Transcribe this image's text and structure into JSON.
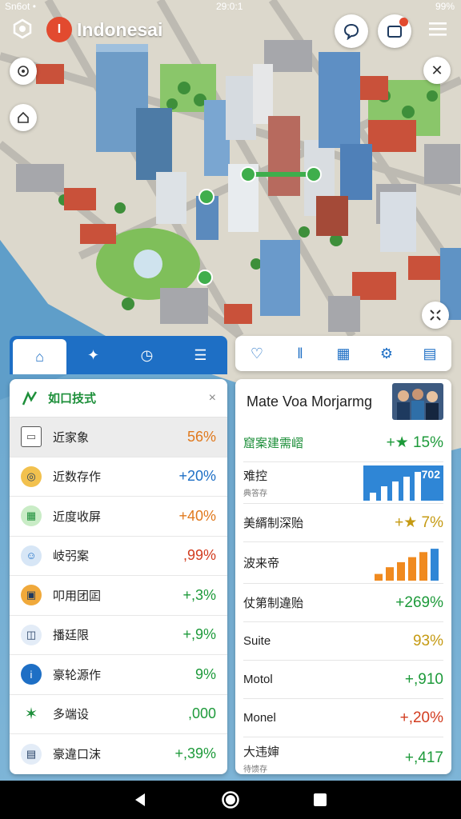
{
  "status_bar": {
    "left": "Sn6ot •",
    "time": "29:0:1",
    "battery": "99%"
  },
  "app": {
    "brand_letter": "I",
    "name": "Indonesai"
  },
  "colors": {
    "accent": "#1e6fc5",
    "brand": "#e24a2f",
    "positive": "#1d9a3a",
    "warning": "#e0791d"
  },
  "left_tabs": [
    {
      "icon": "home-icon",
      "glyph": "⌂"
    },
    {
      "icon": "puzzle-icon",
      "glyph": "✦"
    },
    {
      "icon": "timer-icon",
      "glyph": "◷"
    },
    {
      "icon": "list-icon",
      "glyph": "☰"
    }
  ],
  "right_tabs": [
    {
      "icon": "pin-icon",
      "glyph": "♡"
    },
    {
      "icon": "columns-icon",
      "glyph": "‖"
    },
    {
      "icon": "chart-icon",
      "glyph": "▦"
    },
    {
      "icon": "settings-icon",
      "glyph": "⚙"
    },
    {
      "icon": "window-icon",
      "glyph": "▤"
    }
  ],
  "left_panel": {
    "title": "如口技式",
    "close": "×",
    "rows": [
      {
        "label": "近家象",
        "value": "56%",
        "icon": "document-icon",
        "tone": "orange"
      },
      {
        "label": "近数存作",
        "value": "+20%",
        "icon": "ring-icon",
        "tone": "blue"
      },
      {
        "label": "近度收屏",
        "value": "+40%",
        "icon": "puzzle-icon",
        "tone": "orange"
      },
      {
        "label": "岐弜案",
        "value": ",99%",
        "icon": "face-icon",
        "tone": "red"
      },
      {
        "label": "叩用团囸",
        "value": "+,3%",
        "icon": "badge-icon",
        "tone": "green"
      },
      {
        "label": "播廷限",
        "value": "+,9%",
        "icon": "shield-icon",
        "tone": "green"
      },
      {
        "label": "豪轮源作",
        "value": "9%",
        "icon": "info-icon",
        "tone": "green"
      },
      {
        "label": "多端设",
        "value": ",000",
        "icon": "star-icon",
        "tone": "green"
      },
      {
        "label": "豪違口沫",
        "value": "+,39%",
        "icon": "card-icon",
        "tone": "green"
      }
    ]
  },
  "right_panel": {
    "title": "Mate Voa Morjarmg",
    "rows": [
      {
        "label": "窟案建需嶍",
        "value": "+★ 15%",
        "type": "text"
      },
      {
        "label": "难控",
        "sub": "典答存",
        "value": "702",
        "type": "bar-chart"
      },
      {
        "label": "美縃制深贻",
        "value": "+★ 7%",
        "type": "text"
      },
      {
        "label": "波来帝",
        "value": "",
        "type": "column-chart"
      },
      {
        "label": "仗第制違贻",
        "value": "+269%",
        "type": "text"
      },
      {
        "label": "Suite",
        "value": "93%",
        "type": "text"
      },
      {
        "label": "Motol",
        "value": "+,910",
        "type": "text"
      },
      {
        "label": "Monel",
        "value": "+,20%",
        "type": "text"
      },
      {
        "label": "大违婶",
        "sub": "待馈存",
        "value": "+,417",
        "type": "text"
      }
    ]
  },
  "mini_chart_bars": [
    0.25,
    0.45,
    0.6,
    0.75,
    0.9
  ],
  "mini_chart_cols": [
    0.2,
    0.4,
    0.55,
    0.7,
    0.85,
    0.95
  ]
}
